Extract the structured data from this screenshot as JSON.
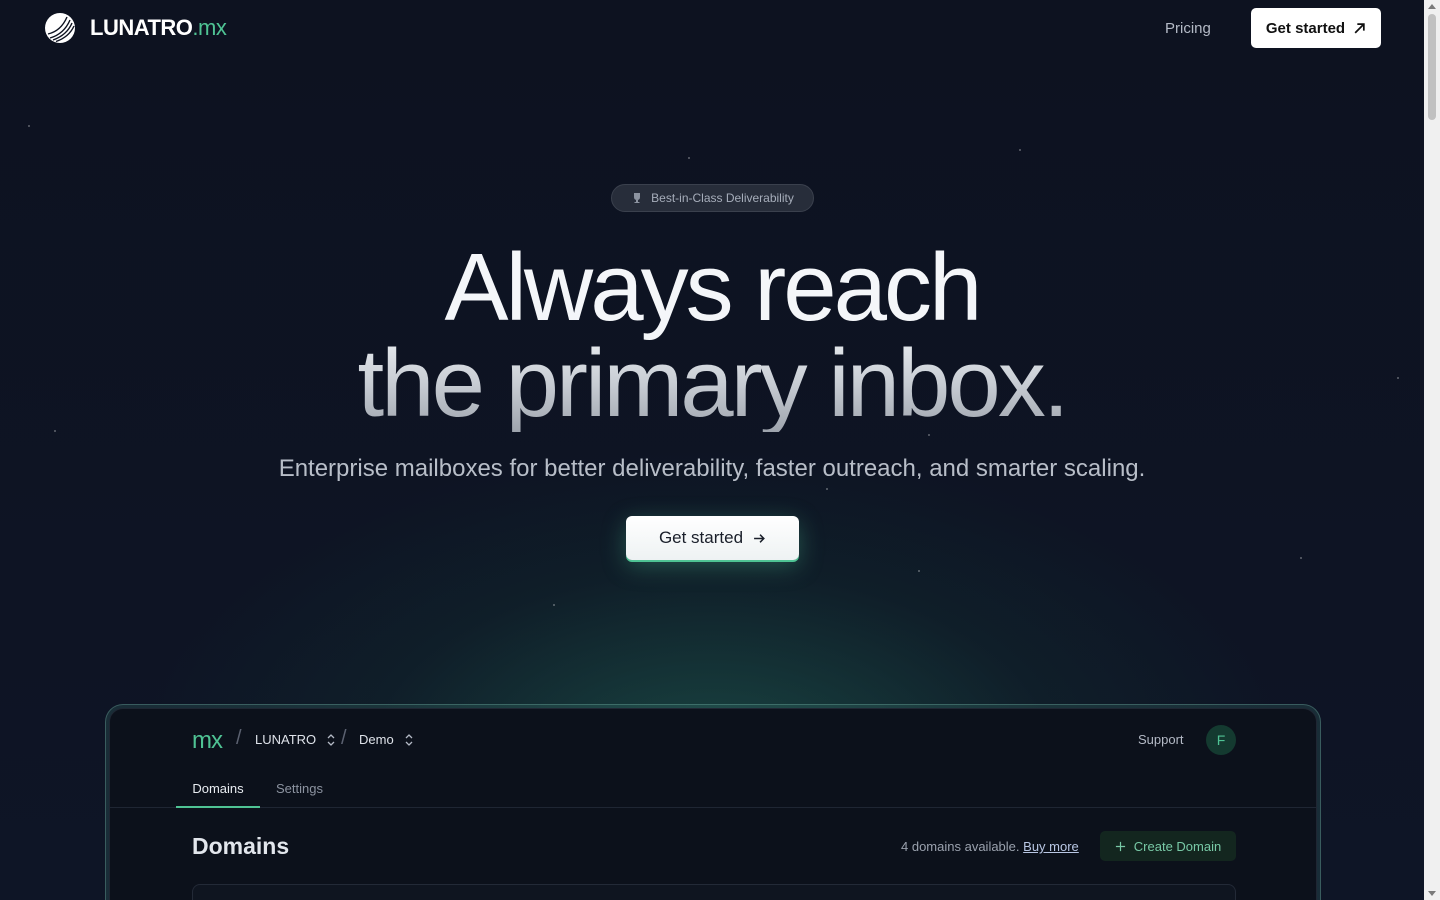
{
  "header": {
    "brand_main": "LUNATRO",
    "brand_accent": ".mx",
    "nav_pricing": "Pricing",
    "cta_label": "Get started"
  },
  "hero": {
    "badge": "Best-in-Class Deliverability",
    "title_line1": "Always reach",
    "title_line2": "the primary inbox.",
    "subtitle": "Enterprise mailboxes for better deliverability, faster outreach, and smarter scaling.",
    "cta_label": "Get started"
  },
  "preview": {
    "logo": "mx",
    "org": "LUNATRO",
    "project": "Demo",
    "support": "Support",
    "avatar_initial": "F",
    "tabs": [
      {
        "label": "Domains",
        "active": true
      },
      {
        "label": "Settings",
        "active": false
      }
    ],
    "heading": "Domains",
    "available_text": "4 domains available.",
    "buy_more": "Buy more",
    "create_button": "Create Domain"
  },
  "colors": {
    "accent": "#4fc394",
    "background": "#0d1220"
  }
}
